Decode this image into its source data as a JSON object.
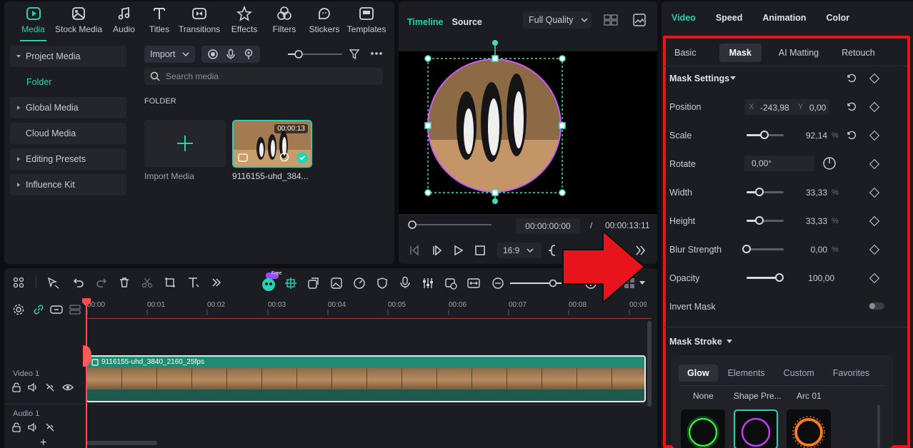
{
  "media_tabs": [
    {
      "label": "Media",
      "icon": "media-icon"
    },
    {
      "label": "Stock Media",
      "icon": "stock-media-icon"
    },
    {
      "label": "Audio",
      "icon": "music-note-icon"
    },
    {
      "label": "Titles",
      "icon": "titles-icon"
    },
    {
      "label": "Transitions",
      "icon": "transitions-icon"
    },
    {
      "label": "Effects",
      "icon": "effects-icon"
    },
    {
      "label": "Filters",
      "icon": "filters-icon"
    },
    {
      "label": "Stickers",
      "icon": "stickers-icon"
    },
    {
      "label": "Templates",
      "icon": "templates-icon"
    }
  ],
  "sidebar": {
    "items": [
      "Project Media",
      "Global Media",
      "Cloud Media",
      "Editing Presets",
      "Influence Kit"
    ],
    "folder": "Folder"
  },
  "media": {
    "import_label": "Import",
    "search_placeholder": "Search media",
    "folder_label": "FOLDER",
    "import_tile_label": "Import Media",
    "clip_duration": "00:00:13",
    "clip_name": "9116155-uhd_384..."
  },
  "preview": {
    "tab_timeline": "Timeline",
    "tab_source": "Source",
    "quality": "Full Quality",
    "current_time": "00:00:00:00",
    "separator": "/",
    "total_time": "00:00:13:11",
    "ratio": "16:9"
  },
  "timeline": {
    "ticks": [
      "00:00",
      "00:01",
      "00:02",
      "00:03",
      "00:04",
      "00:05",
      "00:06",
      "00:07",
      "00:08",
      "00:09"
    ],
    "free_badge": "Free",
    "video_track": "Video 1",
    "audio_track": "Audio 1",
    "clip_title": "9116155-uhd_3840_2160_25fps",
    "add_symbol": "+"
  },
  "props": {
    "top_tabs": [
      "Video",
      "Speed",
      "Animation",
      "Color"
    ],
    "sub_tabs": [
      "Basic",
      "Mask",
      "AI Matting",
      "Retouch"
    ],
    "mask_settings": "Mask Settings",
    "position": {
      "label": "Position",
      "x_label": "X",
      "x": "-243,98",
      "y_label": "Y",
      "y": "0,00"
    },
    "scale": {
      "label": "Scale",
      "value": "92,14",
      "unit": "%",
      "level": 0.48
    },
    "rotate": {
      "label": "Rotate",
      "value": "0,00°"
    },
    "width": {
      "label": "Width",
      "value": "33,33",
      "unit": "%",
      "level": 0.35
    },
    "height": {
      "label": "Height",
      "value": "33,33",
      "unit": "%",
      "level": 0.35
    },
    "blur": {
      "label": "Blur Strength",
      "value": "0,00",
      "unit": "%",
      "level": 0.0
    },
    "opacity": {
      "label": "Opacity",
      "value": "100,00",
      "level": 1.0
    },
    "invert_mask": "Invert Mask",
    "mask_stroke": "Mask Stroke",
    "stroke_tabs": [
      "Glow",
      "Elements",
      "Custom",
      "Favorites"
    ],
    "presets": [
      "None",
      "Shape Pre...",
      "Arc 01"
    ]
  },
  "colors": {
    "accent": "#23d3b3",
    "highlight": "#e8141b"
  }
}
